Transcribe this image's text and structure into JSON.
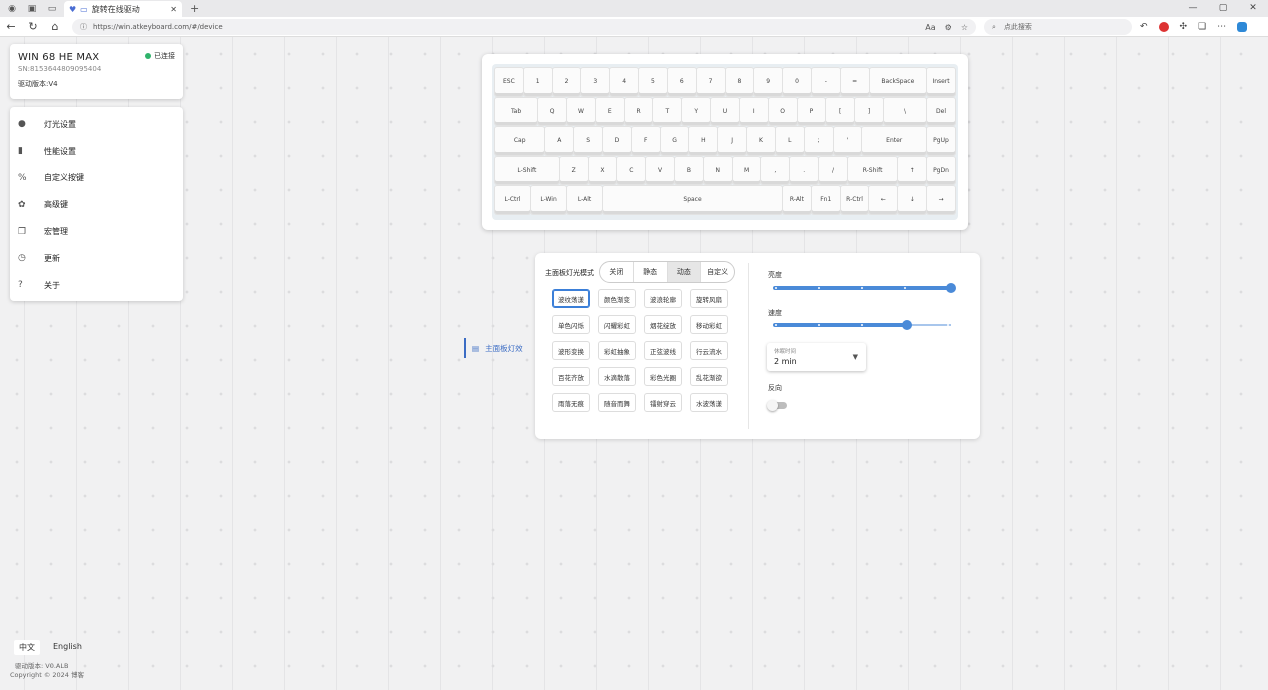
{
  "browser": {
    "tab_title": "旋转在线驱动",
    "url": "https://win.atkeyboard.com/#/device",
    "search_placeholder": "点此搜索",
    "translate_icon": "Aa"
  },
  "device": {
    "name": "WIN 68 HE MAX",
    "sn": "SN:8153644809095404",
    "firmware": "驱动版本:V4",
    "status": "已连接"
  },
  "menu": [
    {
      "label": "灯光设置",
      "icon": "lightbulb-icon",
      "glyph": "●"
    },
    {
      "label": "性能设置",
      "icon": "chart-icon",
      "glyph": "▮"
    },
    {
      "label": "自定义按键",
      "icon": "percent-icon",
      "glyph": "%"
    },
    {
      "label": "高级键",
      "icon": "gear-icon",
      "glyph": "✿"
    },
    {
      "label": "宏管理",
      "icon": "copy-icon",
      "glyph": "❐"
    },
    {
      "label": "更新",
      "icon": "history-icon",
      "glyph": "◷"
    },
    {
      "label": "关于",
      "icon": "question-icon",
      "glyph": "?"
    }
  ],
  "keyboard": {
    "rows": [
      [
        {
          "l": "ESC",
          "w": 1
        },
        {
          "l": "1",
          "w": 1
        },
        {
          "l": "2",
          "w": 1
        },
        {
          "l": "3",
          "w": 1
        },
        {
          "l": "4",
          "w": 1
        },
        {
          "l": "5",
          "w": 1
        },
        {
          "l": "6",
          "w": 1
        },
        {
          "l": "7",
          "w": 1
        },
        {
          "l": "8",
          "w": 1
        },
        {
          "l": "9",
          "w": 1
        },
        {
          "l": "0",
          "w": 1
        },
        {
          "l": "-",
          "w": 1
        },
        {
          "l": "=",
          "w": 1
        },
        {
          "l": "BackSpace",
          "w": 2
        },
        {
          "l": "Insert",
          "w": 1
        }
      ],
      [
        {
          "l": "Tab",
          "w": 1.5
        },
        {
          "l": "Q",
          "w": 1
        },
        {
          "l": "W",
          "w": 1
        },
        {
          "l": "E",
          "w": 1
        },
        {
          "l": "R",
          "w": 1
        },
        {
          "l": "T",
          "w": 1
        },
        {
          "l": "Y",
          "w": 1
        },
        {
          "l": "U",
          "w": 1
        },
        {
          "l": "I",
          "w": 1
        },
        {
          "l": "O",
          "w": 1
        },
        {
          "l": "P",
          "w": 1
        },
        {
          "l": "[",
          "w": 1
        },
        {
          "l": "]",
          "w": 1
        },
        {
          "l": "\\",
          "w": 1.5
        },
        {
          "l": "Del",
          "w": 1
        }
      ],
      [
        {
          "l": "Cap",
          "w": 1.75
        },
        {
          "l": "A",
          "w": 1
        },
        {
          "l": "S",
          "w": 1
        },
        {
          "l": "D",
          "w": 1
        },
        {
          "l": "F",
          "w": 1
        },
        {
          "l": "G",
          "w": 1
        },
        {
          "l": "H",
          "w": 1
        },
        {
          "l": "J",
          "w": 1
        },
        {
          "l": "K",
          "w": 1
        },
        {
          "l": "L",
          "w": 1
        },
        {
          "l": ";",
          "w": 1
        },
        {
          "l": "'",
          "w": 1
        },
        {
          "l": "Enter",
          "w": 2.25
        },
        {
          "l": "PgUp",
          "w": 1
        }
      ],
      [
        {
          "l": "L-Shift",
          "w": 2.25
        },
        {
          "l": "Z",
          "w": 1
        },
        {
          "l": "X",
          "w": 1
        },
        {
          "l": "C",
          "w": 1
        },
        {
          "l": "V",
          "w": 1
        },
        {
          "l": "B",
          "w": 1
        },
        {
          "l": "N",
          "w": 1
        },
        {
          "l": "M",
          "w": 1
        },
        {
          "l": ",",
          "w": 1
        },
        {
          "l": ".",
          "w": 1
        },
        {
          "l": "/",
          "w": 1
        },
        {
          "l": "R-Shift",
          "w": 1.75
        },
        {
          "l": "↑",
          "w": 1
        },
        {
          "l": "PgDn",
          "w": 1
        }
      ],
      [
        {
          "l": "L-Ctrl",
          "w": 1.25
        },
        {
          "l": "L-Win",
          "w": 1.25
        },
        {
          "l": "L-Alt",
          "w": 1.25
        },
        {
          "l": "Space",
          "w": 6.25
        },
        {
          "l": "R-Alt",
          "w": 1
        },
        {
          "l": "Fn1",
          "w": 1
        },
        {
          "l": "R-Ctrl",
          "w": 1
        },
        {
          "l": "←",
          "w": 1
        },
        {
          "l": "↓",
          "w": 1
        },
        {
          "l": "→",
          "w": 1
        }
      ]
    ]
  },
  "lighting": {
    "sidelink": "主面板灯效",
    "mode_label": "主面板灯光模式",
    "modes": [
      "关闭",
      "静态",
      "动态",
      "自定义"
    ],
    "active_mode": 2,
    "effects": [
      "波纹荡漾",
      "颜色渐变",
      "波浪轮廓",
      "旋转风扇",
      "单色闪烁",
      "闪耀彩虹",
      "烟花绽放",
      "移动彩虹",
      "波形变换",
      "彩虹抽象",
      "正弦波线",
      "行云流水",
      "百花齐放",
      "水滴散落",
      "彩色光圈",
      "乱花渐欲",
      "雨落无痕",
      "随音而舞",
      "镭射穿云",
      "水波荡漾"
    ],
    "selected_effect": 0,
    "brightness_label": "亮度",
    "brightness": 1.0,
    "speed_label": "速度",
    "speed": 0.75,
    "sleep_caption": "休眠时间",
    "sleep_value": "2 min",
    "reverse_label": "反向",
    "reverse": false
  },
  "footer": {
    "lang_zh": "中文",
    "lang_en": "English",
    "version": "驱动版本: V0.ALB",
    "copyright": "Copyright © 2024 博客"
  }
}
